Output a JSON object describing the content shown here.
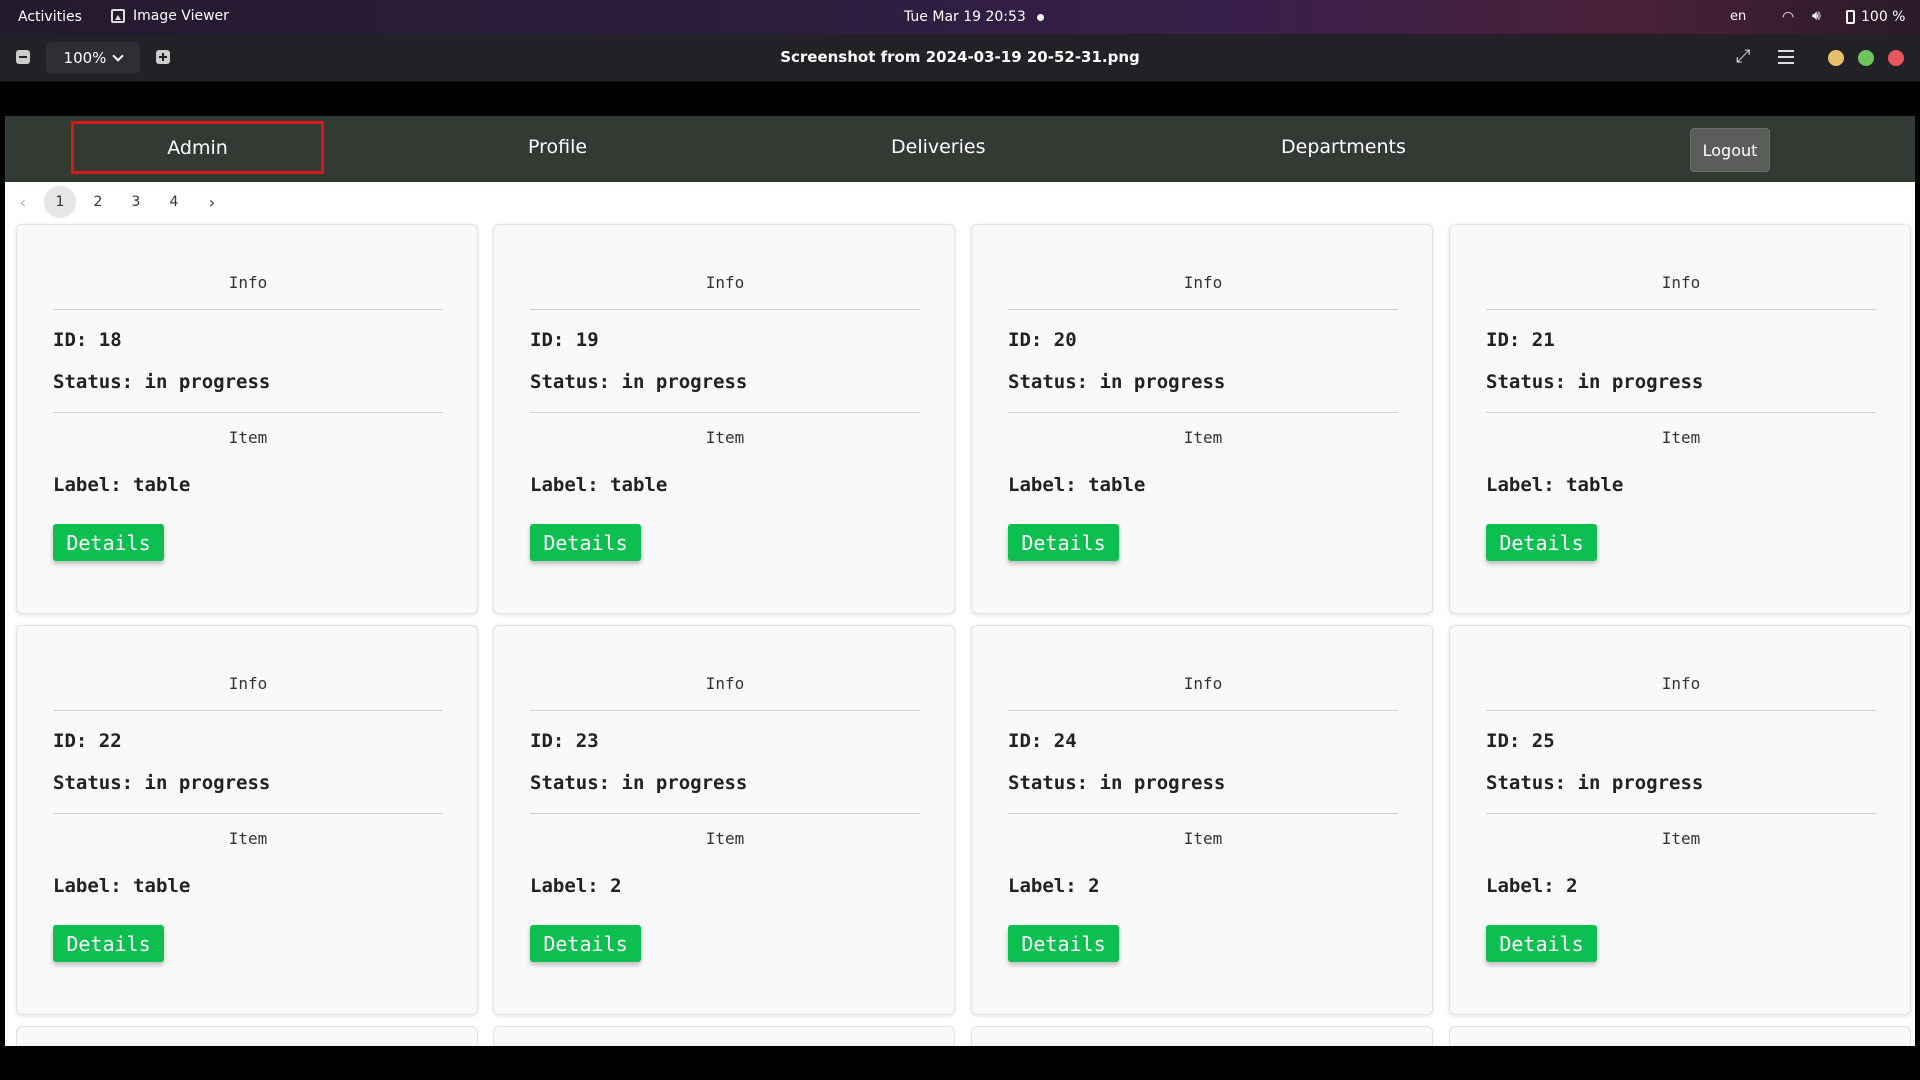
{
  "system": {
    "activities": "Activities",
    "app_name": "Image Viewer",
    "clock": "Tue Mar 19  20:53",
    "lang": "en",
    "battery": "100 %",
    "icons": [
      "wifi-icon",
      "volume-icon",
      "battery-icon"
    ]
  },
  "viewer": {
    "zoom": "100%",
    "filename": "Screenshot from 2024-03-19 20-52-31.png"
  },
  "app": {
    "nav": {
      "admin": "Admin",
      "profile": "Profile",
      "deliveries": "Deliveries",
      "departments": "Departments",
      "logout": "Logout"
    },
    "pagination": {
      "prev": "‹",
      "pages": [
        "1",
        "2",
        "3",
        "4"
      ],
      "next": "›",
      "current": "1"
    },
    "cards": [
      {
        "info_heading": "Info",
        "id": "ID: 18",
        "status": "Status: in progress",
        "item_heading": "Item",
        "label": "Label: table",
        "button": "Details"
      },
      {
        "info_heading": "Info",
        "id": "ID: 19",
        "status": "Status: in progress",
        "item_heading": "Item",
        "label": "Label: table",
        "button": "Details"
      },
      {
        "info_heading": "Info",
        "id": "ID: 20",
        "status": "Status: in progress",
        "item_heading": "Item",
        "label": "Label: table",
        "button": "Details"
      },
      {
        "info_heading": "Info",
        "id": "ID: 21",
        "status": "Status: in progress",
        "item_heading": "Item",
        "label": "Label: table",
        "button": "Details"
      },
      {
        "info_heading": "Info",
        "id": "ID: 22",
        "status": "Status: in progress",
        "item_heading": "Item",
        "label": "Label: table",
        "button": "Details"
      },
      {
        "info_heading": "Info",
        "id": "ID: 23",
        "status": "Status: in progress",
        "item_heading": "Item",
        "label": "Label: 2",
        "button": "Details"
      },
      {
        "info_heading": "Info",
        "id": "ID: 24",
        "status": "Status: in progress",
        "item_heading": "Item",
        "label": "Label: 2",
        "button": "Details"
      },
      {
        "info_heading": "Info",
        "id": "ID: 25",
        "status": "Status: in progress",
        "item_heading": "Item",
        "label": "Label: 2",
        "button": "Details"
      }
    ],
    "colors": {
      "navbar": "#333a33",
      "details_button": "#0dbf50",
      "highlight": "#d7191c"
    }
  }
}
